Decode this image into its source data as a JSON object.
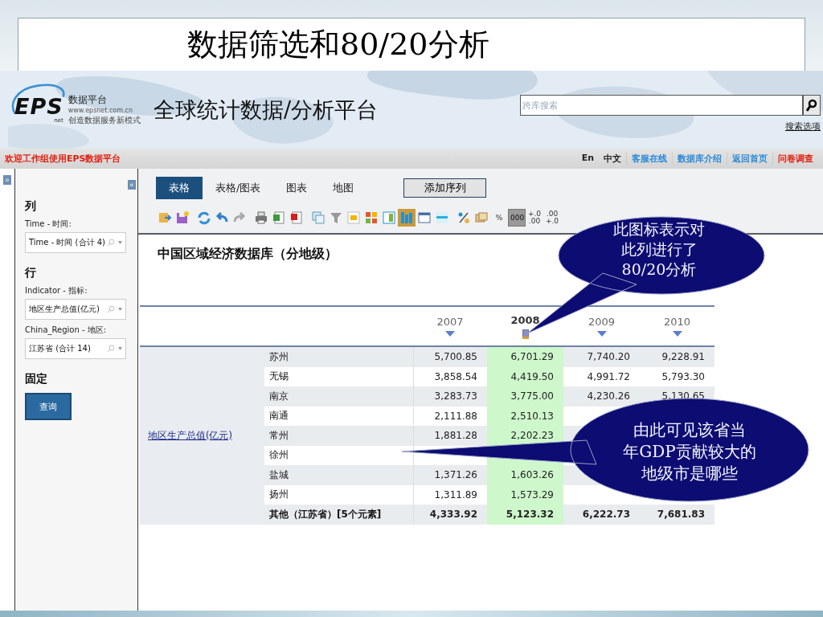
{
  "slide_title": "数据筛选和80/20分析",
  "header": {
    "logo_name": "EPS",
    "logo_sub": "net",
    "logo_tagline": "数据平台",
    "logo_url": "www.epsnet.com.cn",
    "logo_slogan": "创造数据服务新模式",
    "platform_title": "全球统计数据/分析平台",
    "search": {
      "placeholder": "跨库搜索"
    },
    "search_options": "搜索选项"
  },
  "nav": {
    "welcome": "欢迎工作组使用EPS数据平台",
    "links": [
      {
        "label": "En",
        "kind": "lang"
      },
      {
        "label": "中文",
        "kind": "lang"
      },
      {
        "label": "客服在线",
        "kind": "link"
      },
      {
        "label": "数据库介绍",
        "kind": "link"
      },
      {
        "label": "返回首页",
        "kind": "link"
      },
      {
        "label": "问卷调查",
        "kind": "alert"
      }
    ]
  },
  "sidebar": {
    "expand": "»",
    "collapse": "«",
    "sections": [
      {
        "heading": "列",
        "fields": [
          {
            "label": "Time - 时间:",
            "value": "Time - 时间 (合计 4)"
          }
        ]
      },
      {
        "heading": "行",
        "fields": [
          {
            "label": "Indicator - 指标:",
            "value": "地区生产总值(亿元)"
          },
          {
            "label": "China_Region - 地区:",
            "value": "江苏省 (合计 14)"
          }
        ]
      },
      {
        "heading": "固定"
      }
    ],
    "query_button": "查询"
  },
  "view_tabs": [
    {
      "label": "表格",
      "selected": true
    },
    {
      "label": "表格/图表",
      "selected": false
    },
    {
      "label": "图表",
      "selected": false
    },
    {
      "label": "地图",
      "selected": false
    }
  ],
  "add_series": "添加序列",
  "toolbar": [
    {
      "kind": "icon",
      "selected": false
    },
    {
      "kind": "icon",
      "selected": false
    },
    {
      "kind": "sep"
    },
    {
      "kind": "icon",
      "selected": false
    },
    {
      "kind": "icon",
      "selected": false
    },
    {
      "kind": "icon",
      "selected": false
    },
    {
      "kind": "sep"
    },
    {
      "kind": "icon",
      "selected": false
    },
    {
      "kind": "icon",
      "selected": false
    },
    {
      "kind": "icon",
      "selected": false
    },
    {
      "kind": "sep"
    },
    {
      "kind": "icon",
      "selected": false
    },
    {
      "kind": "icon",
      "selected": false
    },
    {
      "kind": "icon",
      "selected": false
    },
    {
      "kind": "icon",
      "selected": false
    },
    {
      "kind": "icon",
      "selected": false
    },
    {
      "kind": "icon",
      "selected": true
    },
    {
      "kind": "icon",
      "selected": false
    },
    {
      "kind": "icon",
      "selected": false
    },
    {
      "kind": "sep"
    },
    {
      "kind": "icon",
      "selected": false
    },
    {
      "kind": "icon",
      "selected": false
    },
    {
      "kind": "text",
      "label": "%",
      "selected": false
    },
    {
      "kind": "text",
      "label": "000",
      "selected": true
    },
    {
      "kind": "text",
      "label": "+.0 .00",
      "selected": false
    },
    {
      "kind": "text",
      "label": ".00 +.0",
      "selected": false
    }
  ],
  "dataset_title": "中国区域经济数据库（分地级）",
  "table": {
    "indicator": "地区生产总值(亿元)",
    "columns": [
      {
        "label": "2007",
        "analyzed": false
      },
      {
        "label": "2008",
        "analyzed": true
      },
      {
        "label": "2009",
        "analyzed": false
      },
      {
        "label": "2010",
        "analyzed": false
      }
    ],
    "rows": [
      {
        "name": "苏州",
        "kind": "city",
        "values": {
          "0": "5,700.85",
          "1": "6,701.29",
          "2": "7,740.20",
          "3": "9,228.91"
        }
      },
      {
        "name": "无锡",
        "kind": "city",
        "values": {
          "0": "3,858.54",
          "1": "4,419.50",
          "2": "4,991.72",
          "3": "5,793.30"
        }
      },
      {
        "name": "南京",
        "kind": "city",
        "values": {
          "0": "3,283.73",
          "1": "3,775.00",
          "2": "4,230.26",
          "3": "5,130.65"
        }
      },
      {
        "name": "南通",
        "kind": "city",
        "values": {
          "0": "2,111.88",
          "1": "2,510.13"
        }
      },
      {
        "name": "常州",
        "kind": "city",
        "values": {
          "0": "1,881.28",
          "1": "2,202.23"
        }
      },
      {
        "name": "徐州",
        "kind": "city"
      },
      {
        "name": "盐城",
        "kind": "city",
        "values": {
          "0": "1,371.26",
          "1": "1,603.26"
        }
      },
      {
        "name": "扬州",
        "kind": "city",
        "values": {
          "0": "1,311.89",
          "1": "1,573.29"
        }
      },
      {
        "name": "其他（江苏省）[5个元素]",
        "kind": "total",
        "values": {
          "0": "4,333.92",
          "1": "5,123.32",
          "2": "6,222.73",
          "3": "7,681.83"
        }
      }
    ]
  },
  "callouts": [
    {
      "lines": [
        "此图标表示对",
        "此列进行了",
        "80/20分析"
      ]
    },
    {
      "lines": [
        "由此可见该省当",
        "年GDP贡献较大的",
        "地级市是哪些"
      ]
    }
  ]
}
